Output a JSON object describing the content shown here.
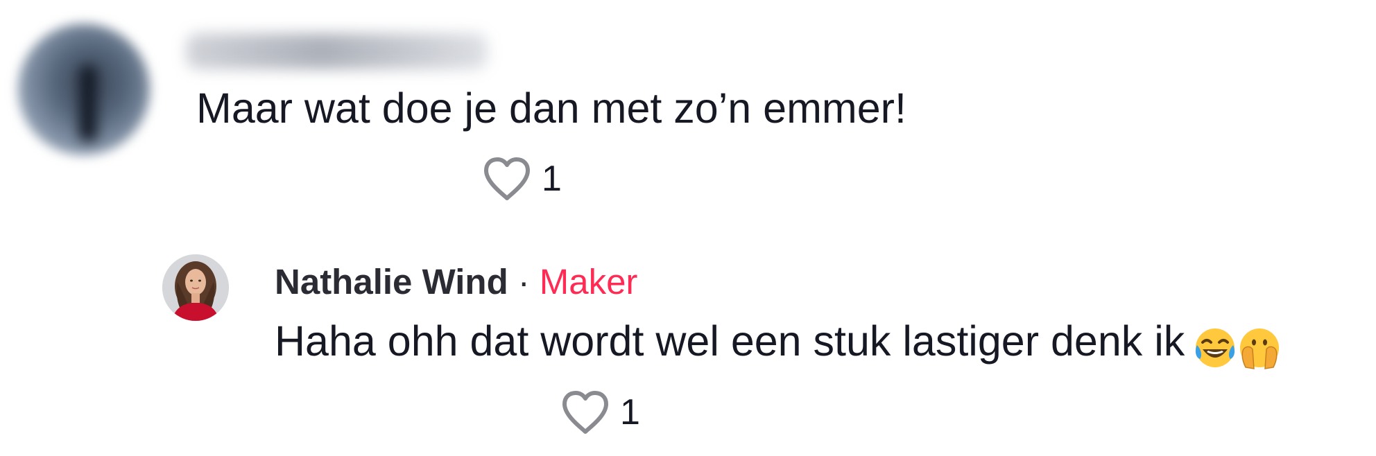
{
  "comment": {
    "text": "Maar wat doe je dan met zo’n emmer!",
    "likes": "1",
    "username_blurred": true,
    "avatar_blurred": true
  },
  "reply": {
    "author": "Nathalie Wind",
    "separator": "·",
    "badge": "Maker",
    "text": "Haha ohh dat wordt wel een stuk lastiger denk ik",
    "emojis": [
      "face-with-tears-of-joy-icon",
      "face-with-open-eyes-and-hand-over-mouth-icon"
    ],
    "likes": "1"
  },
  "colors": {
    "text": "#161823",
    "badge": "#fe2c55",
    "heart_outline": "#8a8b91",
    "background": "#ffffff"
  },
  "icons": {
    "like": "heart-outline-icon"
  }
}
